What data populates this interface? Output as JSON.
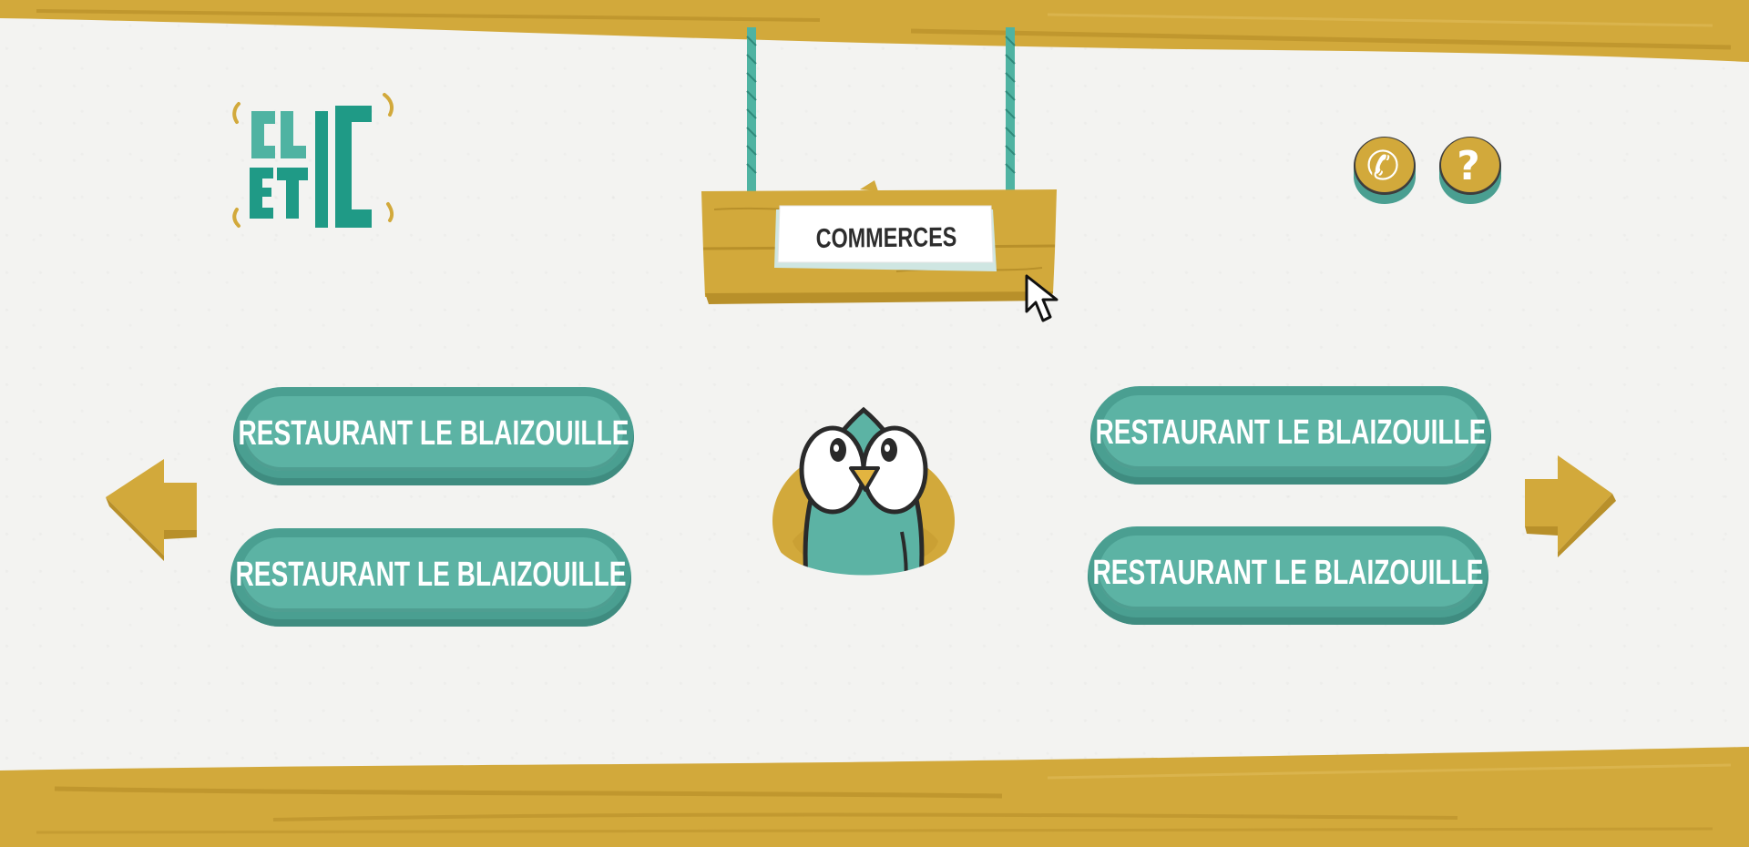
{
  "app": {
    "logo_text": "CLIC ETIC"
  },
  "header": {
    "sign_title": "COMMERCES",
    "buttons": [
      {
        "name": "phone",
        "glyph": "✆"
      },
      {
        "name": "help",
        "glyph": "?"
      }
    ]
  },
  "main": {
    "left_options": [
      {
        "label": "RESTAURANT LE BLAIZOUILLE"
      },
      {
        "label": "RESTAURANT LE BLAIZOUILLE"
      }
    ],
    "right_options": [
      {
        "label": "RESTAURANT LE BLAIZOUILLE"
      },
      {
        "label": "RESTAURANT LE BLAIZOUILLE"
      }
    ]
  },
  "colors": {
    "wood": "#d2a93b",
    "wood_dark": "#b8902a",
    "teal": "#5cb3a4",
    "teal_dark": "#3f8c80",
    "logo_teal": "#1f9a86",
    "background": "#f3f3f1"
  },
  "icons": {
    "phone": "phone-icon",
    "help": "question-icon",
    "prev": "arrow-left-icon",
    "next": "arrow-right-icon",
    "mascot": "bird-mascot",
    "cursor": "mouse-cursor-icon"
  }
}
